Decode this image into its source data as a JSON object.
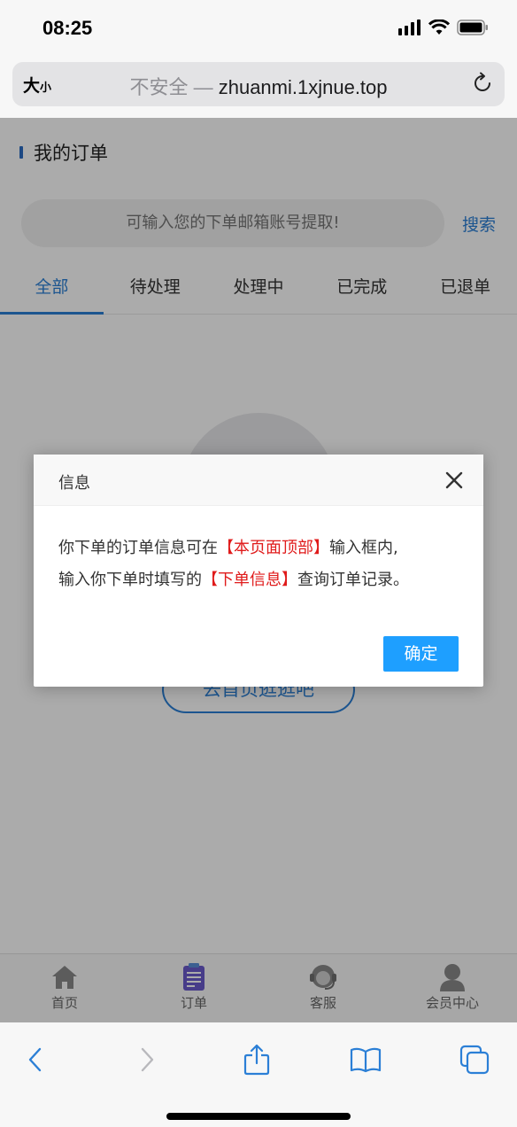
{
  "status_bar": {
    "time": "08:25"
  },
  "address_bar": {
    "text_size_label_big": "大",
    "text_size_label_small": "小",
    "insecure_label": "不安全 — ",
    "host": "zhuanmi.1xjnue.top"
  },
  "page": {
    "title": "我的订单",
    "search": {
      "placeholder": "可输入您的下单邮箱账号提取!",
      "value": "",
      "button_label": "搜索"
    },
    "tabs": [
      {
        "label": "全部",
        "active": true
      },
      {
        "label": "待处理",
        "active": false
      },
      {
        "label": "处理中",
        "active": false
      },
      {
        "label": "已完成",
        "active": false
      },
      {
        "label": "已退单",
        "active": false
      }
    ],
    "empty_state": {
      "button_label": "去首页逛逛吧"
    },
    "bottom_nav": [
      {
        "label": "首页",
        "icon": "home-icon"
      },
      {
        "label": "订单",
        "icon": "order-clipboard-icon"
      },
      {
        "label": "客服",
        "icon": "customer-service-icon"
      },
      {
        "label": "会员中心",
        "icon": "member-icon"
      }
    ]
  },
  "dialog": {
    "title": "信息",
    "line1_prefix": "你下单的订单信息可在",
    "line1_highlight": "【本页面顶部】",
    "line1_suffix": "输入框内,",
    "line2_prefix": "输入你下单时填写的",
    "line2_highlight": "【下单信息】",
    "line2_suffix": "查询订单记录。",
    "ok_label": "确定",
    "highlight_color": "#e01b1b",
    "ok_color": "#1e9fff"
  },
  "accent_color": "#2b7fd6"
}
